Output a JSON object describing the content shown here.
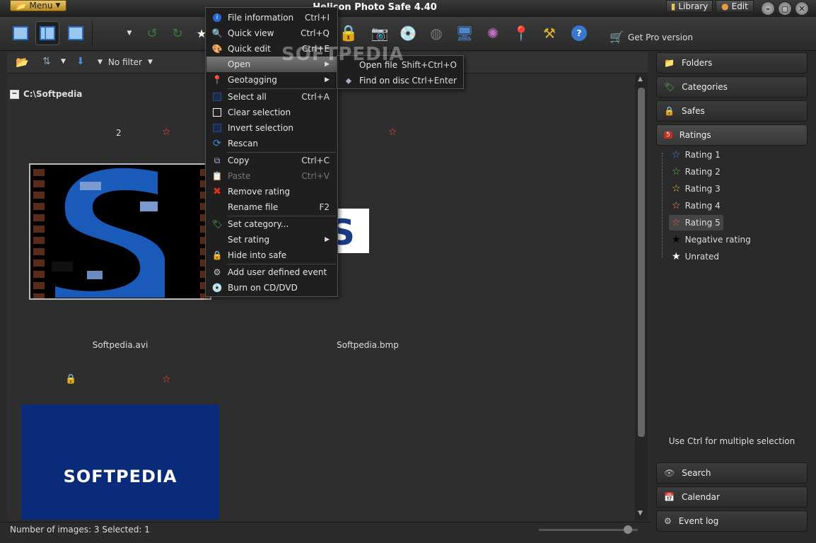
{
  "titlebar": {
    "menu_label": "Menu",
    "app_title": "Helicon Photo Safe 4.40",
    "library_label": "Library",
    "edit_label": "Edit"
  },
  "toolbar": {
    "get_pro_label": "Get Pro version"
  },
  "filter": {
    "no_filter_label": "No filter"
  },
  "content": {
    "path": "C:\\Softpedia",
    "item1_number": "2",
    "item1_caption": "Softpedia.avi",
    "item2_caption": "Softpedia.bmp",
    "item3_logo_text": "SOFTPEDIA",
    "watermark": "SOFTPEDIA"
  },
  "status": {
    "text": "Number of images: 3 Selected: 1"
  },
  "right_panel": {
    "folders": "Folders",
    "categories": "Categories",
    "safes": "Safes",
    "ratings": "Ratings",
    "rating_items": [
      "Rating 1",
      "Rating 2",
      "Rating 3",
      "Rating 4",
      "Rating 5",
      "Negative rating",
      "Unrated"
    ],
    "hint": "Use Ctrl for multiple selection",
    "search": "Search",
    "calendar": "Calendar",
    "event_log": "Event log"
  },
  "context_menu": {
    "items": [
      {
        "label": "File information",
        "shortcut": "Ctrl+I"
      },
      {
        "label": "Quick view",
        "shortcut": "Ctrl+Q"
      },
      {
        "label": "Quick edit",
        "shortcut": "Ctrl+E"
      },
      {
        "label": "Open",
        "shortcut": ""
      },
      {
        "label": "Geotagging",
        "shortcut": ""
      },
      {
        "label": "Select all",
        "shortcut": "Ctrl+A"
      },
      {
        "label": "Clear selection",
        "shortcut": ""
      },
      {
        "label": "Invert selection",
        "shortcut": ""
      },
      {
        "label": "Rescan",
        "shortcut": ""
      },
      {
        "label": "Copy",
        "shortcut": "Ctrl+C"
      },
      {
        "label": "Paste",
        "shortcut": "Ctrl+V"
      },
      {
        "label": "Remove rating",
        "shortcut": ""
      },
      {
        "label": "Rename file",
        "shortcut": "F2"
      },
      {
        "label": "Set category...",
        "shortcut": ""
      },
      {
        "label": "Set rating",
        "shortcut": ""
      },
      {
        "label": "Hide into safe",
        "shortcut": ""
      },
      {
        "label": "Add user defined event",
        "shortcut": ""
      },
      {
        "label": "Burn on CD/DVD",
        "shortcut": ""
      }
    ],
    "submenu": [
      {
        "label": "Open file",
        "shortcut": "Shift+Ctrl+O"
      },
      {
        "label": "Find on disc",
        "shortcut": "Ctrl+Enter"
      }
    ]
  },
  "colors": {
    "background": "#2b2b2b",
    "menu_bg": "#1f1f1f",
    "highlight": "#5f5f5f",
    "rating_star": "#ff5533",
    "softpedia_blue": "#0a2a7a"
  }
}
